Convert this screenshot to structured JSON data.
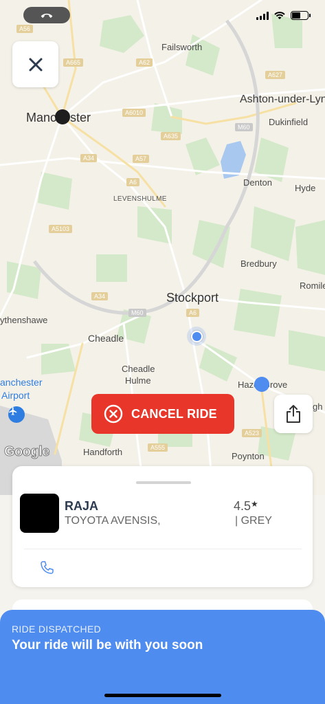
{
  "status_bar": {
    "call_icon": "phone-hangup-icon",
    "signal_icon": "cellular-signal-icon",
    "wifi_icon": "wifi-icon",
    "battery_icon": "battery-icon",
    "battery_level": 0.55
  },
  "map": {
    "places": {
      "failsworth": "Failsworth",
      "manchester": "Manchester",
      "ashton": "Ashton-under-Lyn",
      "dukinfield": "Dukinfield",
      "levenshulme": "LEVENSHULME",
      "denton": "Denton",
      "hyde": "Hyde",
      "bredbury": "Bredbury",
      "romiley": "Romile",
      "stockport": "Stockport",
      "wythenshawe": "ythenshawe",
      "cheadle": "Cheadle",
      "cheadle_hulme_1": "Cheadle",
      "cheadle_hulme_2": "Hulme",
      "hazel_grove": "Hazel Grove",
      "airport_1": "anchester",
      "airport_2": "Airport",
      "handforth": "Handforth",
      "poynton": "Poynton",
      "high_lane": "gh L"
    },
    "roads": {
      "a665": "A665",
      "a62": "A62",
      "a627": "A627",
      "a6010": "A6010",
      "a635": "A635",
      "m60_north": "M60",
      "a34": "A34",
      "a57": "A57",
      "a6_north": "A6",
      "a5103": "A5103",
      "a34_south": "A34",
      "m60_south": "M60",
      "a6_south": "A6",
      "a555": "A555",
      "a523": "A523",
      "a56": "A56"
    },
    "attribution": "Google",
    "accent_blue": "#4f8cef",
    "water_color": "#a8c8f0",
    "park_color": "#d4e9c9"
  },
  "controls": {
    "close_icon": "close-icon",
    "share_icon": "share-icon",
    "cancel_icon": "cancel-circle-icon",
    "cancel_label": "CANCEL RIDE",
    "cancel_color": "#e8372a"
  },
  "driver": {
    "name": "RAJA",
    "car_model": "TOYOTA AVENSIS,",
    "rating": "4.5",
    "rating_star": "★",
    "car_color": "| GREY",
    "phone_icon": "phone-icon"
  },
  "banner": {
    "caption": "RIDE DISPATCHED",
    "title": "Your ride will be with you soon"
  }
}
